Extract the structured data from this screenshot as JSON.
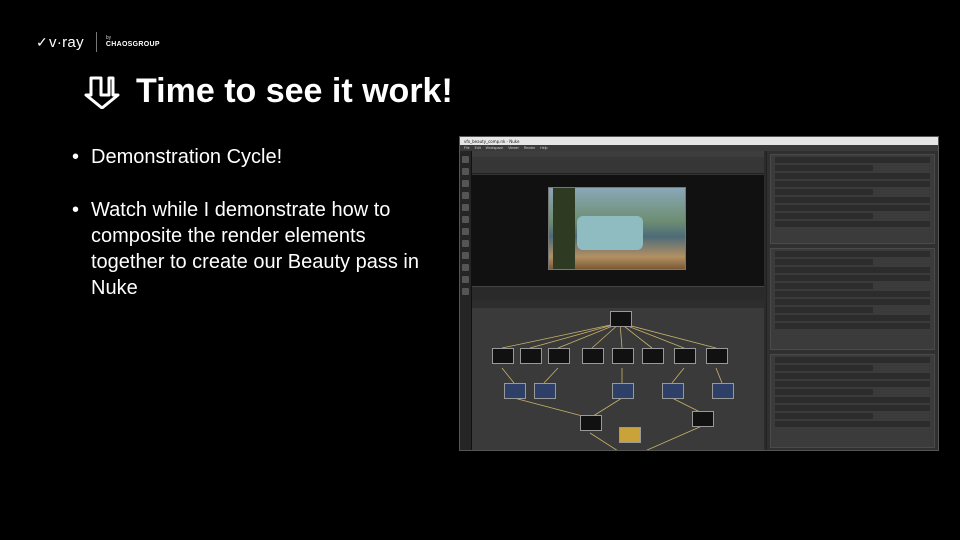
{
  "logo": {
    "brand": "v·ray",
    "by": "by",
    "company": "CHAOSGROUP"
  },
  "slide": {
    "title": "Time to see it work!",
    "title_icon": "arrow-down-icon",
    "bullets": [
      "Demonstration Cycle!",
      "Watch while I demonstrate how to composite the render elements together to create our Beauty pass in Nuke"
    ]
  },
  "screenshot": {
    "app": "Nuke",
    "window_title": "vfx_beauty_comp.nk - Nuke",
    "menu": [
      "File",
      "Edit",
      "Workspace",
      "Viewer",
      "Render",
      "Help"
    ]
  }
}
